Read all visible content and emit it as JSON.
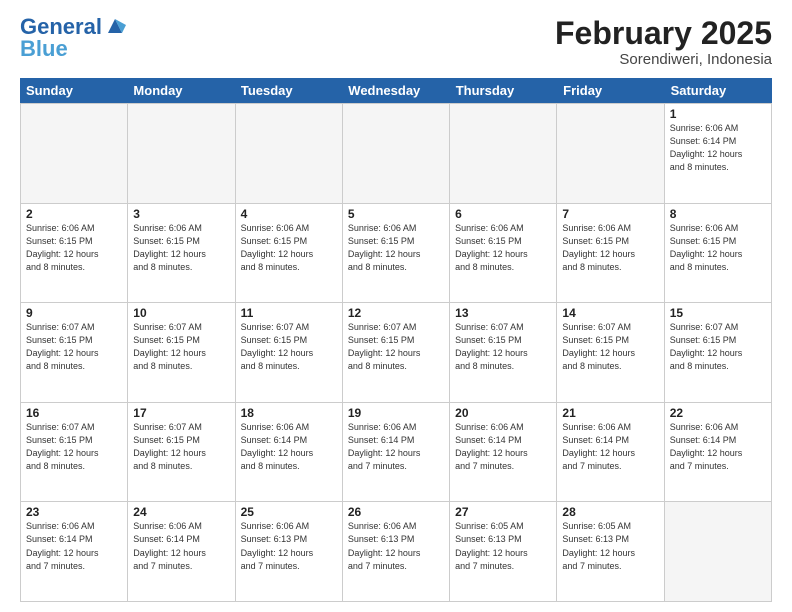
{
  "logo": {
    "line1": "General",
    "line2": "Blue"
  },
  "title": "February 2025",
  "subtitle": "Sorendiweri, Indonesia",
  "days": [
    "Sunday",
    "Monday",
    "Tuesday",
    "Wednesday",
    "Thursday",
    "Friday",
    "Saturday"
  ],
  "weeks": [
    [
      {
        "num": "",
        "info": "",
        "empty": true
      },
      {
        "num": "",
        "info": "",
        "empty": true
      },
      {
        "num": "",
        "info": "",
        "empty": true
      },
      {
        "num": "",
        "info": "",
        "empty": true
      },
      {
        "num": "",
        "info": "",
        "empty": true
      },
      {
        "num": "",
        "info": "",
        "empty": true
      },
      {
        "num": "1",
        "info": "Sunrise: 6:06 AM\nSunset: 6:14 PM\nDaylight: 12 hours\nand 8 minutes.",
        "empty": false
      }
    ],
    [
      {
        "num": "2",
        "info": "Sunrise: 6:06 AM\nSunset: 6:15 PM\nDaylight: 12 hours\nand 8 minutes.",
        "empty": false
      },
      {
        "num": "3",
        "info": "Sunrise: 6:06 AM\nSunset: 6:15 PM\nDaylight: 12 hours\nand 8 minutes.",
        "empty": false
      },
      {
        "num": "4",
        "info": "Sunrise: 6:06 AM\nSunset: 6:15 PM\nDaylight: 12 hours\nand 8 minutes.",
        "empty": false
      },
      {
        "num": "5",
        "info": "Sunrise: 6:06 AM\nSunset: 6:15 PM\nDaylight: 12 hours\nand 8 minutes.",
        "empty": false
      },
      {
        "num": "6",
        "info": "Sunrise: 6:06 AM\nSunset: 6:15 PM\nDaylight: 12 hours\nand 8 minutes.",
        "empty": false
      },
      {
        "num": "7",
        "info": "Sunrise: 6:06 AM\nSunset: 6:15 PM\nDaylight: 12 hours\nand 8 minutes.",
        "empty": false
      },
      {
        "num": "8",
        "info": "Sunrise: 6:06 AM\nSunset: 6:15 PM\nDaylight: 12 hours\nand 8 minutes.",
        "empty": false
      }
    ],
    [
      {
        "num": "9",
        "info": "Sunrise: 6:07 AM\nSunset: 6:15 PM\nDaylight: 12 hours\nand 8 minutes.",
        "empty": false
      },
      {
        "num": "10",
        "info": "Sunrise: 6:07 AM\nSunset: 6:15 PM\nDaylight: 12 hours\nand 8 minutes.",
        "empty": false
      },
      {
        "num": "11",
        "info": "Sunrise: 6:07 AM\nSunset: 6:15 PM\nDaylight: 12 hours\nand 8 minutes.",
        "empty": false
      },
      {
        "num": "12",
        "info": "Sunrise: 6:07 AM\nSunset: 6:15 PM\nDaylight: 12 hours\nand 8 minutes.",
        "empty": false
      },
      {
        "num": "13",
        "info": "Sunrise: 6:07 AM\nSunset: 6:15 PM\nDaylight: 12 hours\nand 8 minutes.",
        "empty": false
      },
      {
        "num": "14",
        "info": "Sunrise: 6:07 AM\nSunset: 6:15 PM\nDaylight: 12 hours\nand 8 minutes.",
        "empty": false
      },
      {
        "num": "15",
        "info": "Sunrise: 6:07 AM\nSunset: 6:15 PM\nDaylight: 12 hours\nand 8 minutes.",
        "empty": false
      }
    ],
    [
      {
        "num": "16",
        "info": "Sunrise: 6:07 AM\nSunset: 6:15 PM\nDaylight: 12 hours\nand 8 minutes.",
        "empty": false
      },
      {
        "num": "17",
        "info": "Sunrise: 6:07 AM\nSunset: 6:15 PM\nDaylight: 12 hours\nand 8 minutes.",
        "empty": false
      },
      {
        "num": "18",
        "info": "Sunrise: 6:06 AM\nSunset: 6:14 PM\nDaylight: 12 hours\nand 8 minutes.",
        "empty": false
      },
      {
        "num": "19",
        "info": "Sunrise: 6:06 AM\nSunset: 6:14 PM\nDaylight: 12 hours\nand 7 minutes.",
        "empty": false
      },
      {
        "num": "20",
        "info": "Sunrise: 6:06 AM\nSunset: 6:14 PM\nDaylight: 12 hours\nand 7 minutes.",
        "empty": false
      },
      {
        "num": "21",
        "info": "Sunrise: 6:06 AM\nSunset: 6:14 PM\nDaylight: 12 hours\nand 7 minutes.",
        "empty": false
      },
      {
        "num": "22",
        "info": "Sunrise: 6:06 AM\nSunset: 6:14 PM\nDaylight: 12 hours\nand 7 minutes.",
        "empty": false
      }
    ],
    [
      {
        "num": "23",
        "info": "Sunrise: 6:06 AM\nSunset: 6:14 PM\nDaylight: 12 hours\nand 7 minutes.",
        "empty": false
      },
      {
        "num": "24",
        "info": "Sunrise: 6:06 AM\nSunset: 6:14 PM\nDaylight: 12 hours\nand 7 minutes.",
        "empty": false
      },
      {
        "num": "25",
        "info": "Sunrise: 6:06 AM\nSunset: 6:13 PM\nDaylight: 12 hours\nand 7 minutes.",
        "empty": false
      },
      {
        "num": "26",
        "info": "Sunrise: 6:06 AM\nSunset: 6:13 PM\nDaylight: 12 hours\nand 7 minutes.",
        "empty": false
      },
      {
        "num": "27",
        "info": "Sunrise: 6:05 AM\nSunset: 6:13 PM\nDaylight: 12 hours\nand 7 minutes.",
        "empty": false
      },
      {
        "num": "28",
        "info": "Sunrise: 6:05 AM\nSunset: 6:13 PM\nDaylight: 12 hours\nand 7 minutes.",
        "empty": false
      },
      {
        "num": "",
        "info": "",
        "empty": true
      }
    ]
  ]
}
